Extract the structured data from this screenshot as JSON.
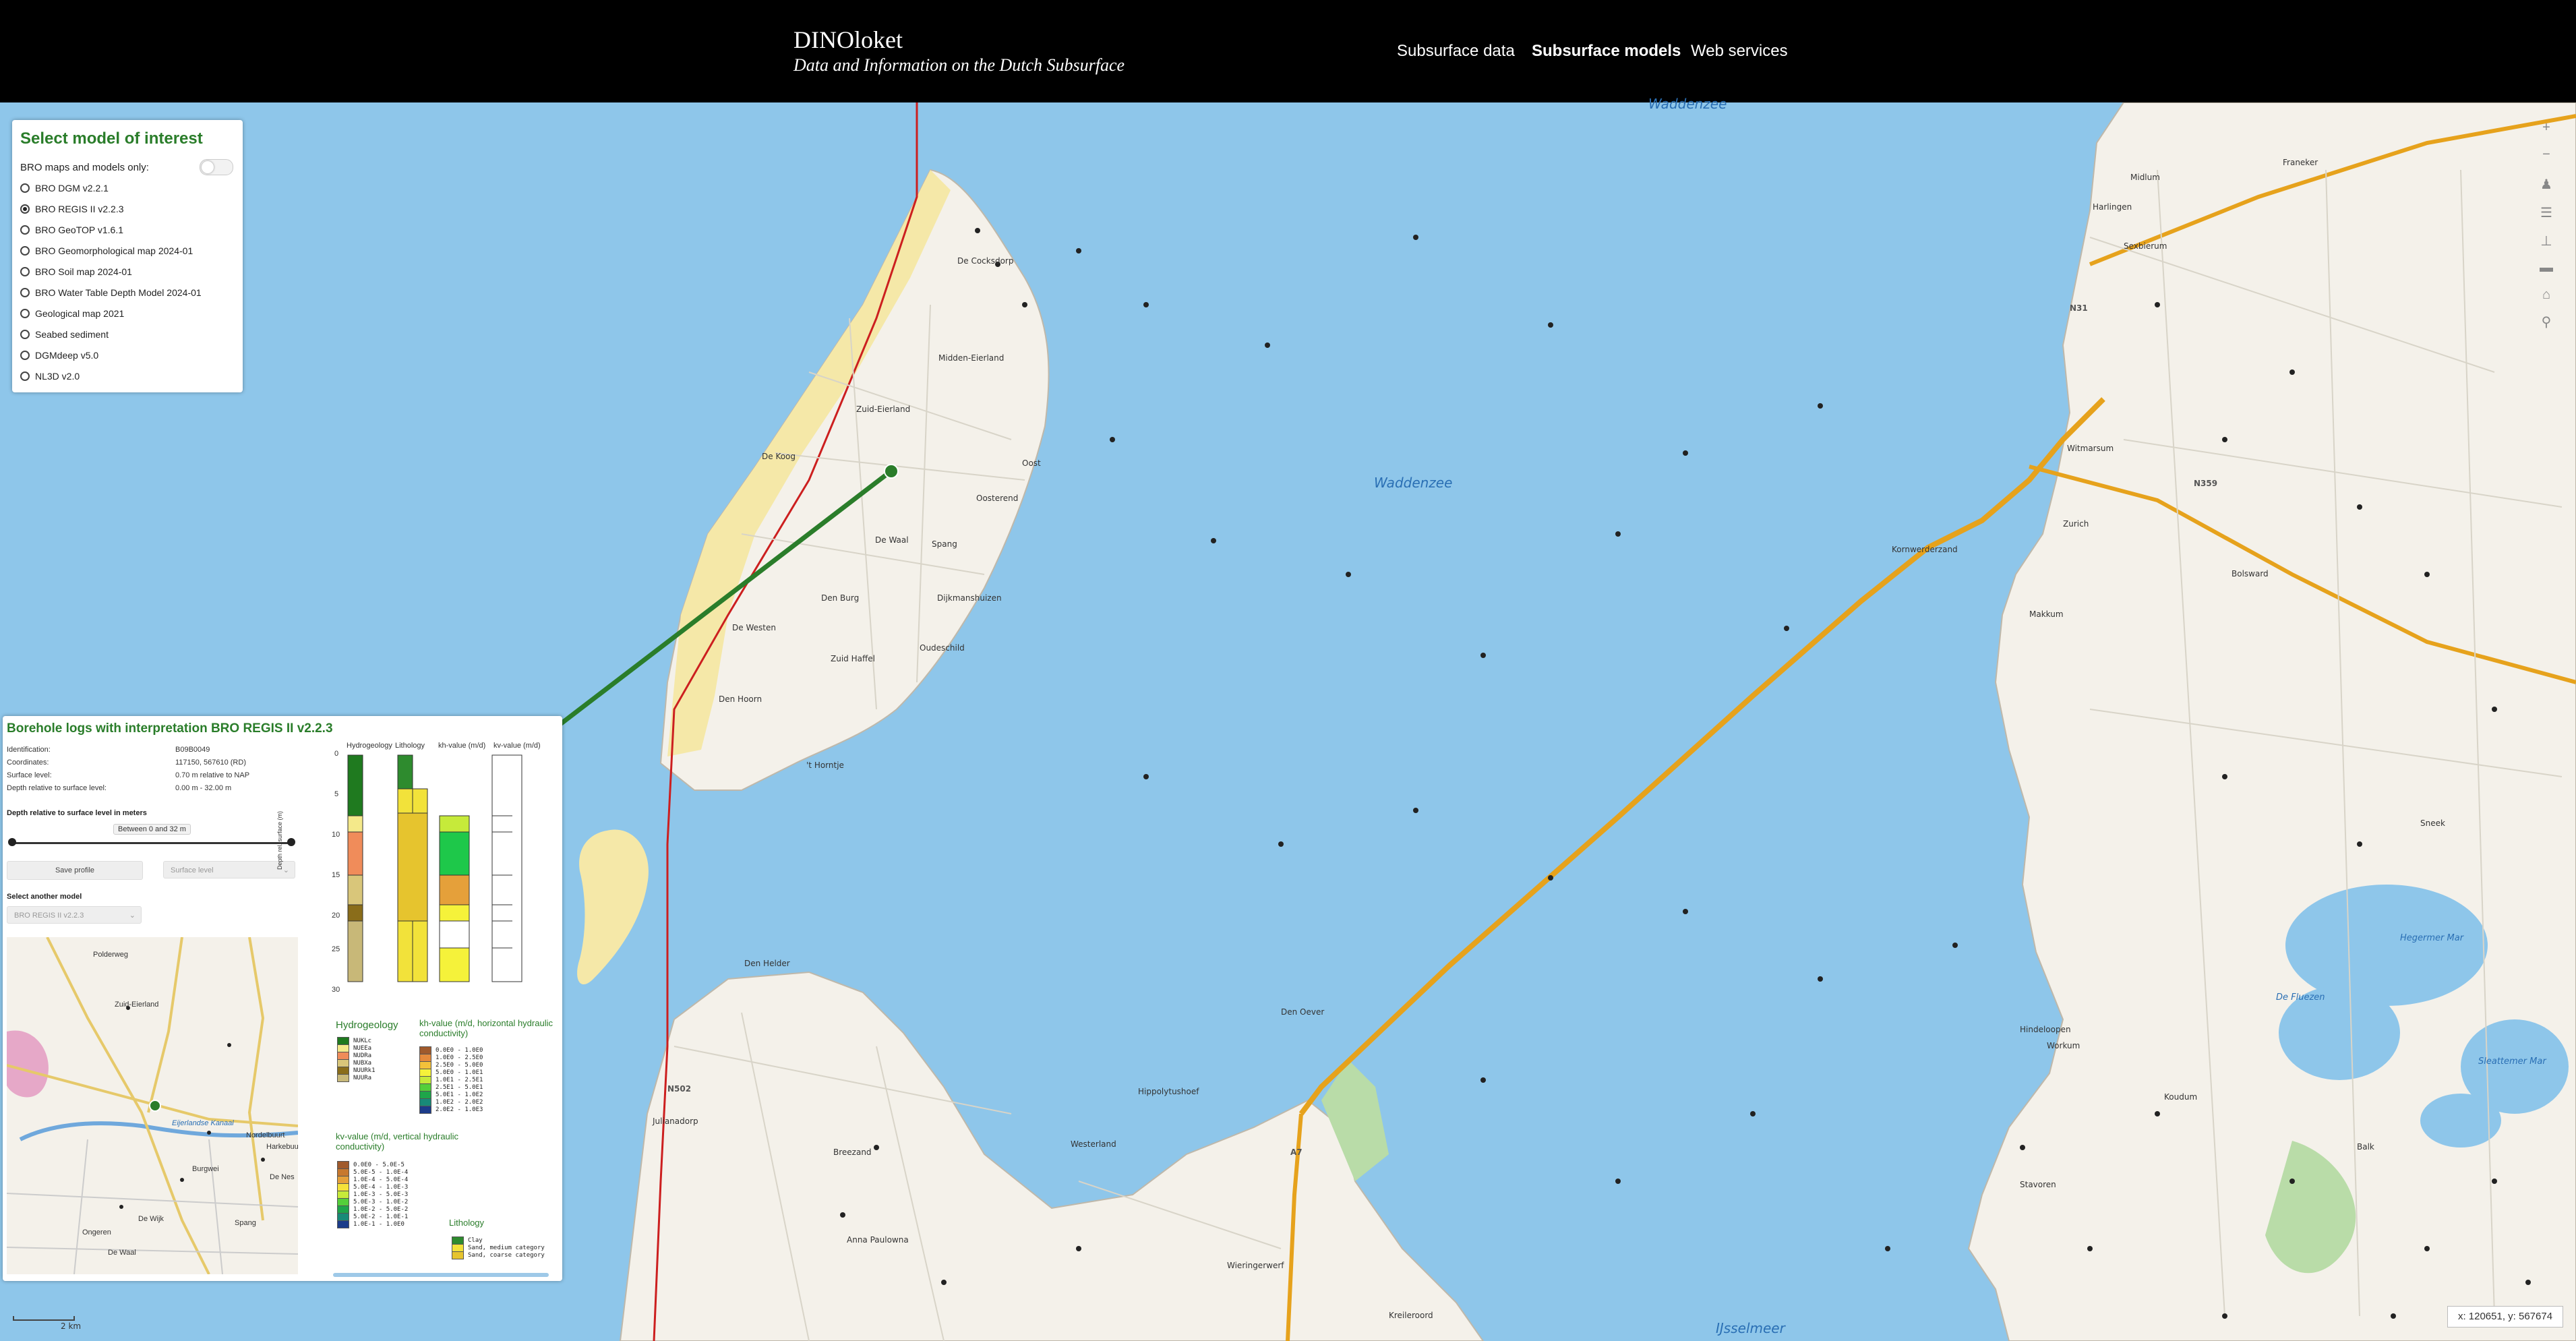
{
  "header": {
    "title": "DINOloket",
    "subtitle": "Data and Information on the Dutch Subsurface",
    "nav": [
      "Subsurface data",
      "Subsurface models",
      "Web services"
    ],
    "active_nav": "Subsurface models"
  },
  "select_panel": {
    "title": "Select model of interest",
    "bro_only_label": "BRO maps and models only:",
    "selected": "BRO REGIS II v2.2.3",
    "models": [
      "BRO DGM v2.2.1",
      "BRO REGIS II v2.2.3",
      "BRO GeoTOP v1.6.1",
      "BRO Geomorphological map 2024-01",
      "BRO Soil map 2024-01",
      "BRO Water Table Depth Model 2024-01",
      "Geological map 2021",
      "Seabed sediment",
      "DGMdeep v5.0",
      "NL3D v2.0"
    ]
  },
  "borehole_panel": {
    "title": "Borehole logs with interpretation BRO REGIS II v2.2.3",
    "fields": [
      {
        "label": "Identification:",
        "value": "B09B0049"
      },
      {
        "label": "Coordinates:",
        "value": "117150, 567610 (RD)"
      },
      {
        "label": "Surface level:",
        "value": "0.70 m relative to NAP"
      },
      {
        "label": "Depth relative to surface level:",
        "value": "0.00 m - 32.00 m"
      }
    ],
    "depth_label": "Depth relative to surface level in meters",
    "depth_range": "Between 0 and 32 m",
    "save_profile": "Save profile",
    "surface_level_select": "Surface level",
    "select_another_model": "Select another model",
    "model_select": "BRO REGIS II v2.2.3",
    "column_headers": [
      "Hydrogeology",
      "Lithology",
      "kh-value (m/d)",
      "kv-value (m/d)"
    ],
    "depth_axis_label": "Depth rel. surface (m)",
    "depth_ticks": [
      "0",
      "5",
      "10",
      "15",
      "20",
      "25",
      "30"
    ],
    "legends": {
      "hydrogeology_title": "Hydrogeology",
      "hydrogeology": [
        {
          "code": "NUKLc",
          "color": "#1f7a1f"
        },
        {
          "code": "NUEEa",
          "color": "#f4e98a"
        },
        {
          "code": "NUDRa",
          "color": "#f08c5a"
        },
        {
          "code": "NUBXa",
          "color": "#d9c67a"
        },
        {
          "code": "NUURk1",
          "color": "#8a6d1a"
        },
        {
          "code": "NUURa",
          "color": "#c8b878"
        }
      ],
      "kh_title": "kh-value (m/d, horizontal hydraulic conductivity)",
      "kh": [
        {
          "code": "0.0E0 - 1.0E0",
          "color": "#a05a2c"
        },
        {
          "code": "1.0E0 - 2.5E0",
          "color": "#e58a3c"
        },
        {
          "code": "2.5E0 - 5.0E0",
          "color": "#f3c13a"
        },
        {
          "code": "5.0E0 - 1.0E1",
          "color": "#f5f23a"
        },
        {
          "code": "1.0E1 - 2.5E1",
          "color": "#c6ea3a"
        },
        {
          "code": "2.5E1 - 5.0E1",
          "color": "#54cf3a"
        },
        {
          "code": "5.0E1 - 1.0E2",
          "color": "#1ea54a"
        },
        {
          "code": "1.0E2 - 2.0E2",
          "color": "#188a78"
        },
        {
          "code": "2.0E2 - 1.0E3",
          "color": "#1c3c8a"
        }
      ],
      "kv_title": "kv-value (m/d, vertical hydraulic conductivity)",
      "kv": [
        {
          "code": "0.0E0 - 5.0E-5",
          "color": "#a05a2c"
        },
        {
          "code": "5.0E-5 - 1.0E-4",
          "color": "#c7782e"
        },
        {
          "code": "1.0E-4 - 5.0E-4",
          "color": "#e5a03a"
        },
        {
          "code": "5.0E-4 - 1.0E-3",
          "color": "#f5e23a"
        },
        {
          "code": "1.0E-3 - 5.0E-3",
          "color": "#c6ea3a"
        },
        {
          "code": "5.0E-3 - 1.0E-2",
          "color": "#54cf3a"
        },
        {
          "code": "1.0E-2 - 5.0E-2",
          "color": "#1ea54a"
        },
        {
          "code": "5.0E-2 - 1.0E-1",
          "color": "#188a78"
        },
        {
          "code": "1.0E-1 - 1.0E0",
          "color": "#1c3c8a"
        }
      ],
      "lithology_title": "Lithology",
      "lithology": [
        {
          "code": "Clay",
          "color": "#2e8b2e"
        },
        {
          "code": "Sand, medium category",
          "color": "#f2e23a"
        },
        {
          "code": "Sand, coarse category",
          "color": "#e6c42e"
        }
      ]
    },
    "minimap_labels": [
      "Zuid-Eierland",
      "Eijerlandse Kanaal",
      "Nordelbuurt",
      "Burgwei",
      "De Nes",
      "Harkebuur",
      "De Wijk",
      "Spang",
      "Ongeren",
      "De Waal",
      "Polderweg"
    ]
  },
  "map": {
    "water_labels": [
      "Waddenzee",
      "Waddenzee",
      "IJsselmeer",
      "Hegermer Mar",
      "De Fluezen",
      "Sleattemer Mar"
    ],
    "towns": [
      "De Cocksdorp",
      "Midden-Eierland",
      "Zuid-Eierland",
      "De Koog",
      "Oosterend",
      "Oost",
      "De Waal",
      "Spang",
      "Den Burg",
      "De Westen",
      "Zuid Haffel",
      "Oudeschild",
      "Den Hoorn",
      "'t Horntje",
      "Dijkmanshuizen",
      "Den Helder",
      "Julianadorp",
      "Den Oever",
      "Hippolytushoef",
      "Westerland",
      "Wieringerwerf",
      "Anna Paulowna",
      "Breezand",
      "Kreileroord",
      "Harlingen",
      "Franeker",
      "Midlum",
      "Sexbierum",
      "Kornwerderzand",
      "Makkum",
      "Bolsward",
      "Witmarsum",
      "Workum",
      "Stavoren",
      "Hindeloopen",
      "Koudum",
      "Balk",
      "Sneek",
      "Zurich"
    ],
    "road_labels": [
      "N31",
      "N359",
      "N502",
      "A7"
    ],
    "scale_label": "2 km",
    "coordinates": "x: 120651, y: 567674"
  }
}
